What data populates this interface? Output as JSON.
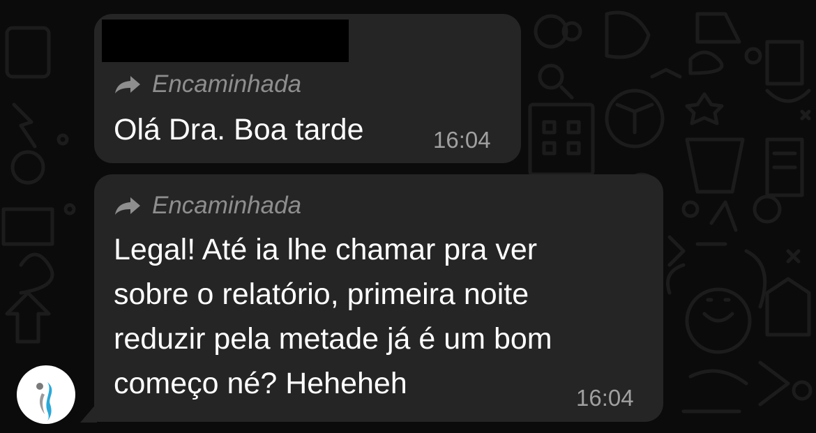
{
  "chat": {
    "messages": [
      {
        "sender_visible": false,
        "forwarded_label": "Encaminhada",
        "text": "Olá Dra. Boa tarde",
        "time": "16:04"
      },
      {
        "forwarded_label": "Encaminhada",
        "text": "Legal! Até ia lhe chamar pra ver\nsobre o relatório, primeira noite\nreduzir pela metade já é um bom\ncomeço né? Heheheh",
        "time": "16:04"
      }
    ]
  },
  "colors": {
    "background": "#0b0b0b",
    "bubble": "#252525",
    "message_text": "#ffffff",
    "meta_text": "#8e8e8e",
    "avatar_accent": "#2aa8d8"
  },
  "icons": {
    "forward": "forward-arrow-icon",
    "avatar": "contact-avatar-logo"
  }
}
